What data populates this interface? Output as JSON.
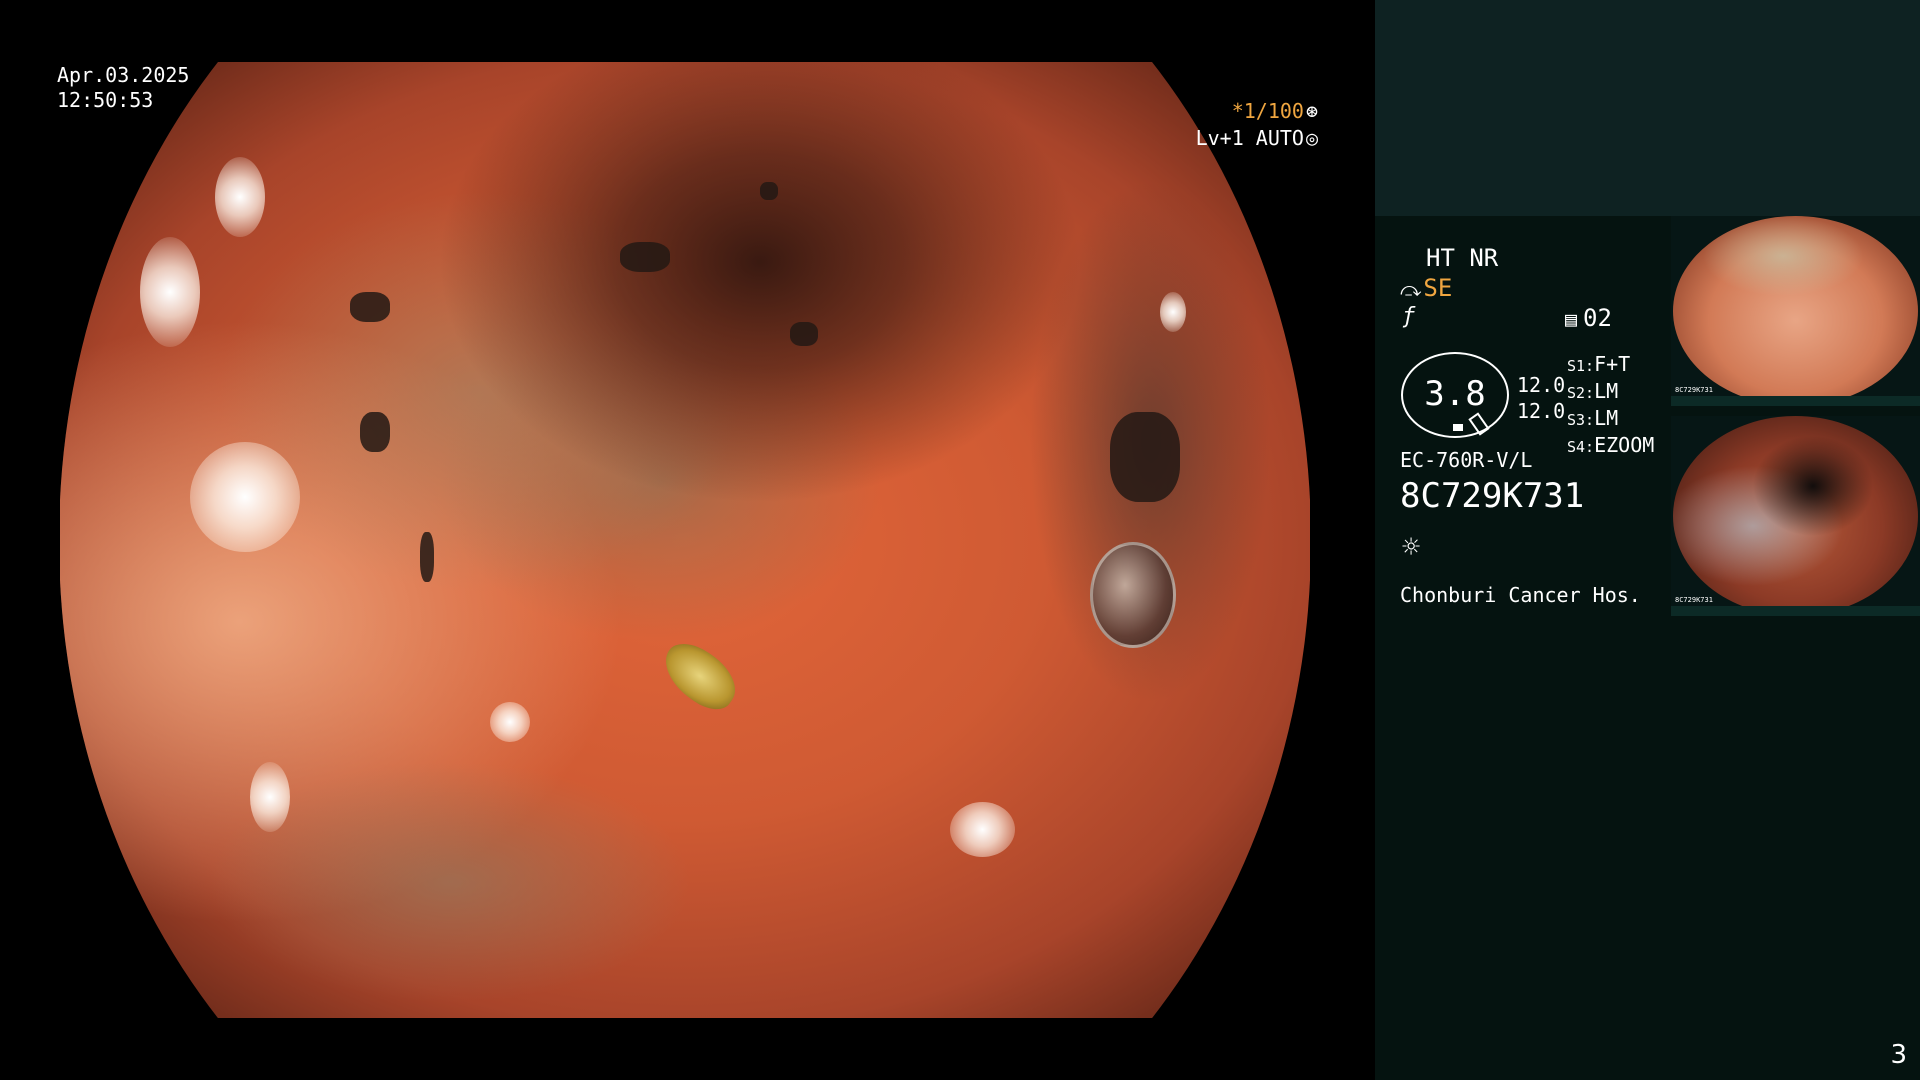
{
  "overlay": {
    "date": "Apr.03.2025",
    "time": "12:50:53",
    "shutter": "*1/100",
    "level": "Lv+1 AUTO"
  },
  "panel": {
    "ht_nr": "HT NR",
    "se": "SE",
    "num": "02",
    "dial_value": "3.8",
    "val1": "12.0",
    "val2": "12.0",
    "settings": [
      {
        "key": "S1:",
        "value": "F+T"
      },
      {
        "key": "S2:",
        "value": "LM"
      },
      {
        "key": "S3:",
        "value": "LM"
      },
      {
        "key": "S4:",
        "value": "EZOOM"
      }
    ],
    "scope_model": "EC-760R-V/L",
    "serial": "8C729K731",
    "hospital": "Chonburi Cancer Hos."
  },
  "thumbnails": [
    {
      "serial": "8C729K731"
    },
    {
      "serial": "8C729K731"
    }
  ],
  "page_number": "3",
  "icons": {
    "shutter": "aperture-icon",
    "level": "iris-icon",
    "function": "scope-function-icon",
    "freeze": "freeze-f-icon",
    "memo": "memo-icon",
    "light": "sun-icon"
  },
  "colors": {
    "accent_orange": "#f0a640",
    "panel_bg": "#051310",
    "panel_top": "#0e2222"
  }
}
